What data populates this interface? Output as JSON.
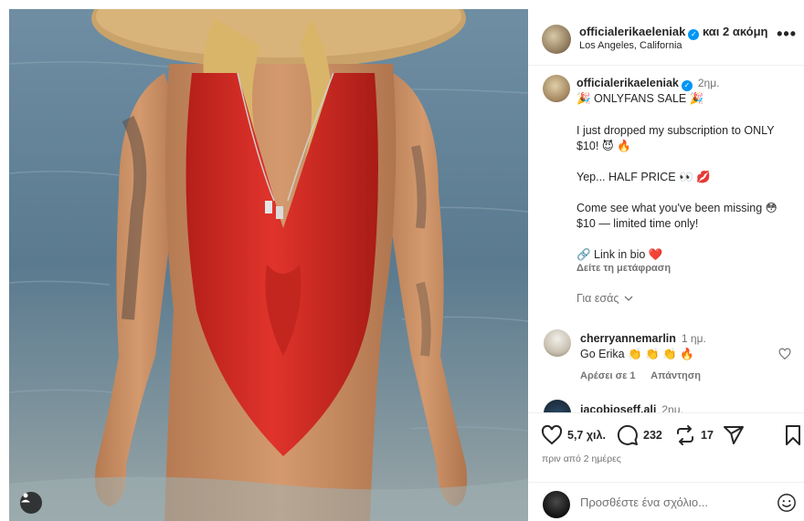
{
  "post": {
    "header": {
      "username": "officialerikaeleniak",
      "and_more": "και 2 ακόμη",
      "location": "Los Angeles, California",
      "more_icon": "more-horizontal-icon"
    },
    "caption": {
      "username": "officialerikaeleniak",
      "time": "2ημ.",
      "lines": [
        "🎉 ONLYFANS SALE 🎉",
        "I just dropped my subscription to ONLY",
        "$10! 😈 🔥",
        "Yep... HALF PRICE 👀 💋",
        "Come see what you've been missing 😳",
        "$10 — limited time only!",
        "🔗 Link in bio ❤️"
      ],
      "translate": "Δείτε τη μετάφραση",
      "for_you": "Για εσάς"
    },
    "comments": [
      {
        "username": "cherryannemarlin",
        "time": "1 ημ.",
        "text": "Go Erika 👏 👏 👏 🔥",
        "likes": "Αρέσει σε 1",
        "reply": "Απάντηση"
      },
      {
        "username": "jacobjoseff.ali",
        "time": "2ημ."
      }
    ],
    "actions": {
      "likes": "5,7 χιλ.",
      "comments": "232",
      "reposts": "17",
      "posted_ago": "πριν από 2 ημέρες"
    },
    "add_comment": {
      "placeholder": "Προσθέστε ένα σχόλιο..."
    }
  },
  "colors": {
    "verified": "#0095f6",
    "text_primary": "#262626",
    "text_secondary": "#737373",
    "swimsuit": "#d42a22"
  }
}
